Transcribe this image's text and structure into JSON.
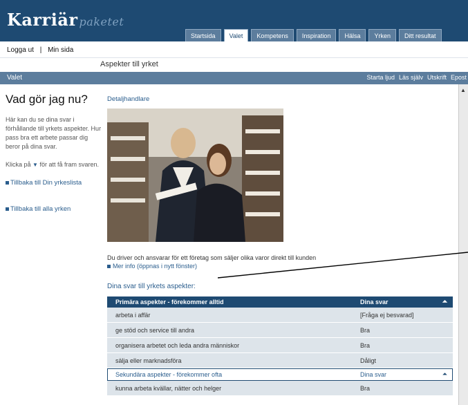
{
  "header": {
    "logo_main": "Karriär",
    "logo_suffix": "paketet",
    "tabs": [
      {
        "label": "Startsida"
      },
      {
        "label": "Valet"
      },
      {
        "label": "Kompetens"
      },
      {
        "label": "Inspiration"
      },
      {
        "label": "Hälsa"
      },
      {
        "label": "Yrken"
      },
      {
        "label": "Ditt resultat"
      }
    ]
  },
  "userbar": {
    "logout": "Logga ut",
    "separator": "|",
    "mypage": "Min sida"
  },
  "subtitle": "Aspekter till yrket",
  "section": {
    "name": "Valet",
    "tools": [
      "Starta ljud",
      "Läs själv",
      "Utskrift",
      "Epost"
    ]
  },
  "left": {
    "heading": "Vad gör jag nu?",
    "intro": "Här kan du se dina svar i förhållande till yrkets aspekter. Hur pass bra ett arbete passar dig beror på dina svar.",
    "hint_before": "Klicka på",
    "hint_after": "för att få fram svaren.",
    "link_list": "Tillbaka till Din yrkeslista",
    "link_all": "Tillbaka till alla yrken"
  },
  "content": {
    "crumb": "Detaljhandlare",
    "description": "Du driver och ansvarar för ett företag som säljer olika varor direkt till kunden",
    "more_info": "Mer info (öppnas i nytt fönster)",
    "aspects_title": "Dina svar till yrkets aspekter:"
  },
  "table": {
    "primary": {
      "title": "Primära aspekter - förekommer alltid",
      "answer_header": "Dina svar",
      "rows": [
        {
          "aspect": "arbeta i affär",
          "answer": "[Fråga ej besvarad]"
        },
        {
          "aspect": "ge stöd och service till andra",
          "answer": "Bra"
        },
        {
          "aspect": "organisera arbetet och leda andra människor",
          "answer": "Bra"
        },
        {
          "aspect": "sälja eller marknadsföra",
          "answer": "Dåligt"
        }
      ]
    },
    "secondary": {
      "title": "Sekundära aspekter - förekommer ofta",
      "answer_header": "Dina svar",
      "rows": [
        {
          "aspect": "kunna arbeta kvällar, nätter och helger",
          "answer": "Bra"
        }
      ]
    }
  },
  "icons": {
    "collapse": "collapse-up-icon",
    "expand": "down-triangle-icon",
    "bullet": "square-bullet-icon"
  },
  "colors": {
    "header_bg": "#1e4a72",
    "section_bg": "#5c7d9d",
    "link": "#2a5d8d",
    "row_bg": "#dde4ea"
  }
}
